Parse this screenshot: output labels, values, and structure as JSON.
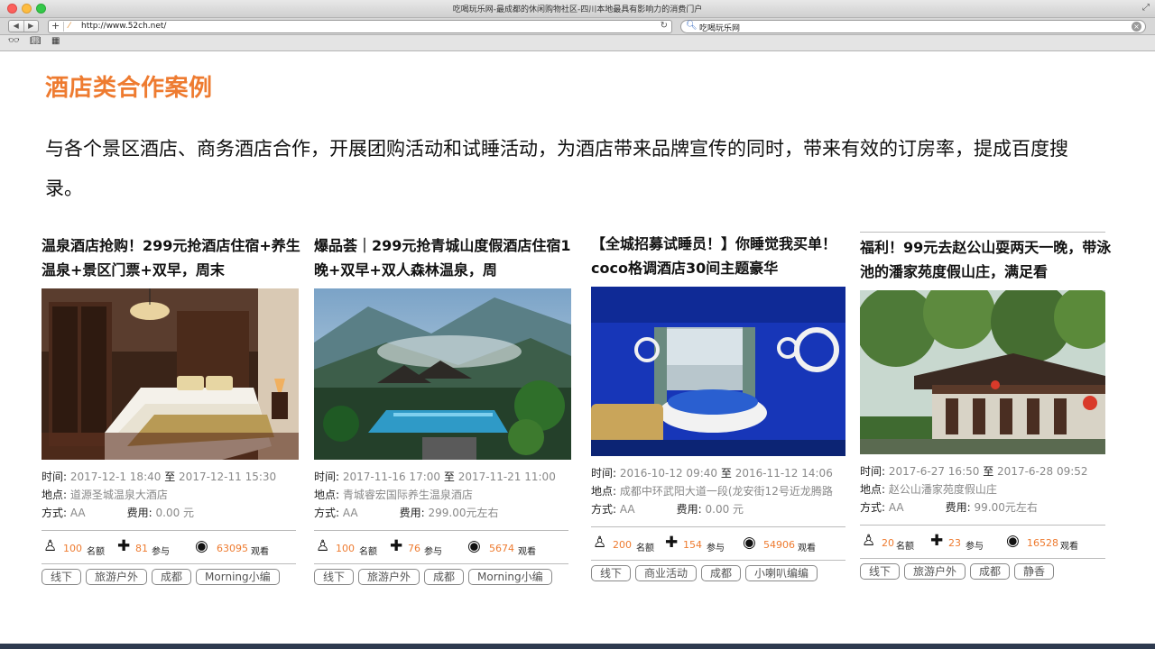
{
  "window": {
    "title": "吃喝玩乐网-最成都的休闲购物社区-四川本地最具有影响力的消费门户",
    "url": "http://www.52ch.net/",
    "search_value": "吃喝玩乐网"
  },
  "page": {
    "heading": "酒店类合作案例",
    "description": "与各个景区酒店、商务酒店合作，开展团购活动和试睡活动，为酒店带来品牌宣传的同时，带来有效的订房率，提成百度搜录。"
  },
  "labels": {
    "time": "时间:",
    "to": "至",
    "location": "地点:",
    "method": "方式:",
    "fee": "费用:",
    "quota": "名额",
    "join": "参与",
    "views": "观看"
  },
  "cards": [
    {
      "title": "温泉酒店抢购！299元抢酒店住宿+养生温泉+景区门票+双早，周末",
      "start": "2017-12-1 18:40",
      "end": "2017-12-11 15:30",
      "location": "道源圣城温泉大酒店",
      "method": "AA",
      "fee": "0.00 元",
      "quota": "100",
      "join": "81",
      "views": "63095",
      "tags": [
        "线下",
        "旅游户外",
        "成都",
        "Morning小编"
      ]
    },
    {
      "title": "爆品荟｜299元抢青城山度假酒店住宿1晚+双早+双人森林温泉，周",
      "start": "2017-11-16 17:00",
      "end": "2017-11-21 11:00",
      "location": "青城睿宏国际养生温泉酒店",
      "method": "AA",
      "fee": "299.00元左右",
      "quota": "100",
      "join": "76",
      "views": "5674",
      "tags": [
        "线下",
        "旅游户外",
        "成都",
        "Morning小编"
      ]
    },
    {
      "title": "【全城招募试睡员！】你睡觉我买单！coco格调酒店30间主题豪华",
      "start": "2016-10-12 09:40",
      "end": "2016-11-12 14:06",
      "location": "成都中环武阳大道一段(龙安街12号近龙腾路",
      "method": "AA",
      "fee": "0.00 元",
      "quota": "200",
      "join": "154",
      "views": "54906",
      "tags": [
        "线下",
        "商业活动",
        "成都",
        "小喇叭编编"
      ]
    },
    {
      "title": "福利！99元去赵公山耍两天一晚，带泳池的潘家苑度假山庄，满足看",
      "start": "2017-6-27 16:50",
      "end": "2017-6-28 09:52",
      "location": "赵公山潘家苑度假山庄",
      "method": "AA",
      "fee": "99.00元左右",
      "quota": "20",
      "join": "23",
      "views": "16528",
      "tags": [
        "线下",
        "旅游户外",
        "成都",
        "静香"
      ]
    }
  ],
  "colors": {
    "accent": "#ee7b30"
  }
}
